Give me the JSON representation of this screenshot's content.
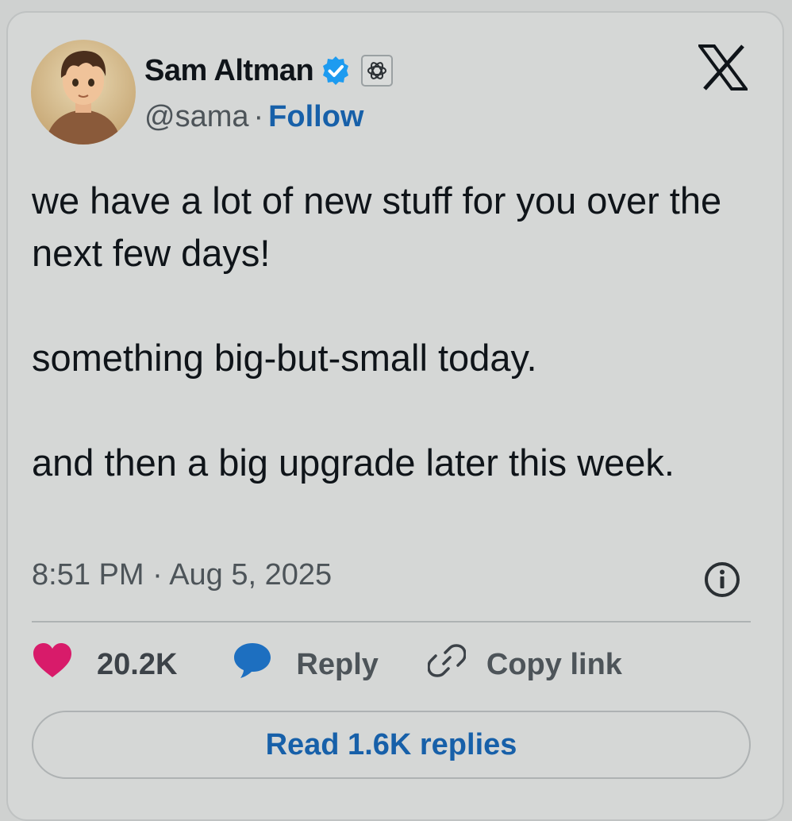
{
  "author": {
    "name": "Sam Altman",
    "handle": "@sama",
    "separator": "·",
    "follow_label": "Follow",
    "verified_color": "#1d9bf0"
  },
  "tweet": {
    "paragraphs": [
      "we have a lot of new stuff for you over the next few days!",
      "something big-but-small today.",
      "and then a big upgrade later this week."
    ],
    "timestamp": "8:51 PM · Aug 5, 2025"
  },
  "actions": {
    "like_count": "20.2K",
    "reply_label": "Reply",
    "copy_link_label": "Copy link"
  },
  "read_replies_label": "Read 1.6K replies",
  "icons": {
    "logo": "x-logo-icon",
    "info": "info-icon",
    "like": "heart-icon",
    "reply": "speech-bubble-icon",
    "copy": "link-icon",
    "affiliate": "openai-badge-icon",
    "verified": "verified-badge-icon"
  },
  "colors": {
    "like": "#d81b6a",
    "reply": "#1d6fc0",
    "link_text": "#1760a9"
  }
}
